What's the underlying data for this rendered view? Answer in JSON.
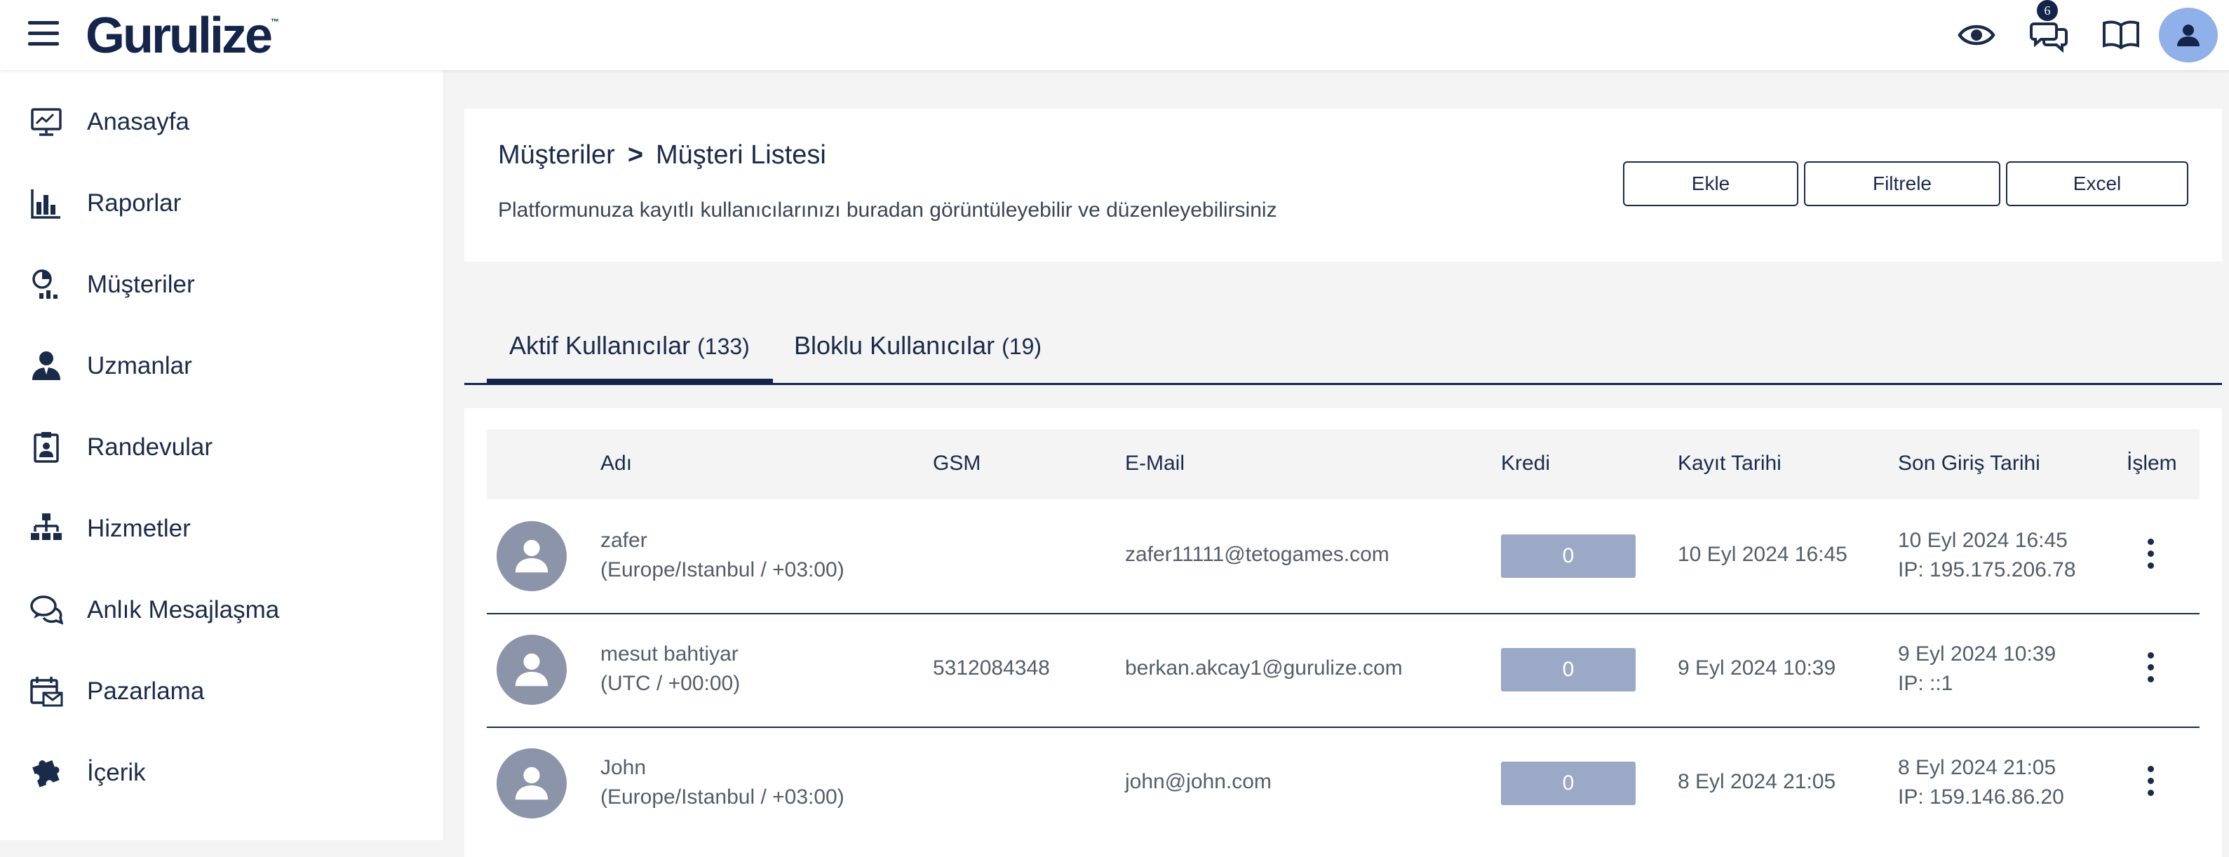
{
  "topbar": {
    "logo": "Gurulize",
    "logo_tm": "™",
    "messages_badge": "6",
    "icons": [
      "menu-icon",
      "eye-icon",
      "chat-icon",
      "book-icon",
      "user-icon"
    ]
  },
  "sidebar": {
    "items": [
      {
        "label": "Anasayfa",
        "icon": "dashboard-icon"
      },
      {
        "label": "Raporlar",
        "icon": "bar-chart-icon"
      },
      {
        "label": "Müşteriler",
        "icon": "customers-icon"
      },
      {
        "label": "Uzmanlar",
        "icon": "expert-icon"
      },
      {
        "label": "Randevular",
        "icon": "clipboard-icon"
      },
      {
        "label": "Hizmetler",
        "icon": "sitemap-icon"
      },
      {
        "label": "Anlık Mesajlaşma",
        "icon": "chat-icon"
      },
      {
        "label": "Pazarlama",
        "icon": "calendar-mail-icon"
      },
      {
        "label": "İçerik",
        "icon": "puzzle-icon"
      }
    ]
  },
  "header": {
    "breadcrumb_parent": "Müşteriler",
    "breadcrumb_sep": ">",
    "breadcrumb_current": "Müşteri Listesi",
    "subtitle": "Platformunuza kayıtlı kullanıcılarınızı buradan görüntüleyebilir ve düzenleyebilirsiniz",
    "buttons": {
      "add": "Ekle",
      "filter": "Filtrele",
      "excel": "Excel"
    }
  },
  "tabs": [
    {
      "label": "Aktif Kullanıcılar",
      "count": "(133)",
      "active": true
    },
    {
      "label": "Bloklu Kullanıcılar",
      "count": "(19)",
      "active": false
    }
  ],
  "table": {
    "columns": [
      "Adı",
      "GSM",
      "E-Mail",
      "Kredi",
      "Kayıt Tarihi",
      "Son Giriş Tarihi",
      "İşlem"
    ],
    "rows": [
      {
        "name": "zafer",
        "timezone": "(Europe/Istanbul / +03:00)",
        "gsm": "",
        "email": "zafer11111@tetogames.com",
        "kredi": "0",
        "kayit": "10 Eyl 2024 16:45",
        "son_giris": "10 Eyl 2024 16:45",
        "ip": "IP: 195.175.206.78"
      },
      {
        "name": "mesut bahtiyar",
        "timezone": "(UTC / +00:00)",
        "gsm": "5312084348",
        "email": "berkan.akcay1@gurulize.com",
        "kredi": "0",
        "kayit": "9 Eyl 2024 10:39",
        "son_giris": "9 Eyl 2024 10:39",
        "ip": "IP: ::1"
      },
      {
        "name": "John",
        "timezone": "(Europe/Istanbul / +03:00)",
        "gsm": "",
        "email": "john@john.com",
        "kredi": "0",
        "kayit": "8 Eyl 2024 21:05",
        "son_giris": "8 Eyl 2024 21:05",
        "ip": "IP: 159.146.86.20"
      }
    ]
  }
}
